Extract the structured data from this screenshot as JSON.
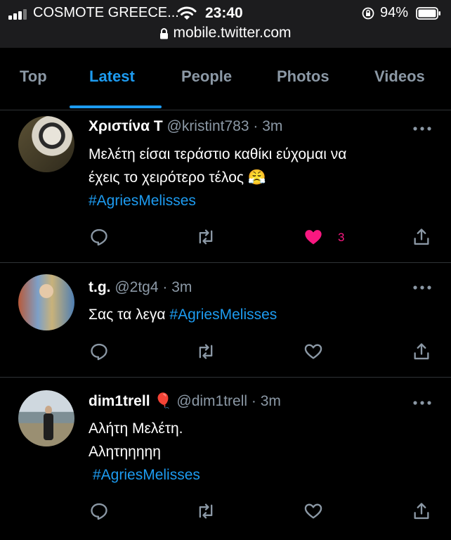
{
  "status_bar": {
    "carrier": "COSMOTE GREECE...",
    "time": "23:40",
    "battery": "94%",
    "url": "mobile.twitter.com"
  },
  "tabs": [
    {
      "label": "Top",
      "active": false
    },
    {
      "label": "Latest",
      "active": true
    },
    {
      "label": "People",
      "active": false
    },
    {
      "label": "Photos",
      "active": false
    },
    {
      "label": "Videos",
      "active": false
    }
  ],
  "tweets": [
    {
      "name": "Χριστίνα Τ",
      "handle": "@kristint783",
      "time": "3m",
      "lines": [
        "Μελέτη είσαι τεράστιο καθίκι εύχομαι να",
        "έχεις το χειρότερο τέλος 😤"
      ],
      "hashtag": "#AgriesMelisses",
      "liked": true,
      "like_count": "3"
    },
    {
      "name": "t.g.",
      "handle": "@2tg4",
      "time": "3m",
      "text": "Σας τα λεγα",
      "hashtag": "#AgriesMelisses",
      "liked": false
    },
    {
      "name": "dim1trell",
      "name_emoji": "🎈",
      "handle": "@dim1trell",
      "time": "3m",
      "lines": [
        "Αλήτη Μελέτη.",
        "Αλητηηηηη"
      ],
      "hashtag": "#AgriesMelisses",
      "liked": false
    }
  ],
  "colors": {
    "accent": "#1d9bf0",
    "like": "#f91880",
    "muted": "#8b98a5",
    "divider": "#2f3336"
  }
}
